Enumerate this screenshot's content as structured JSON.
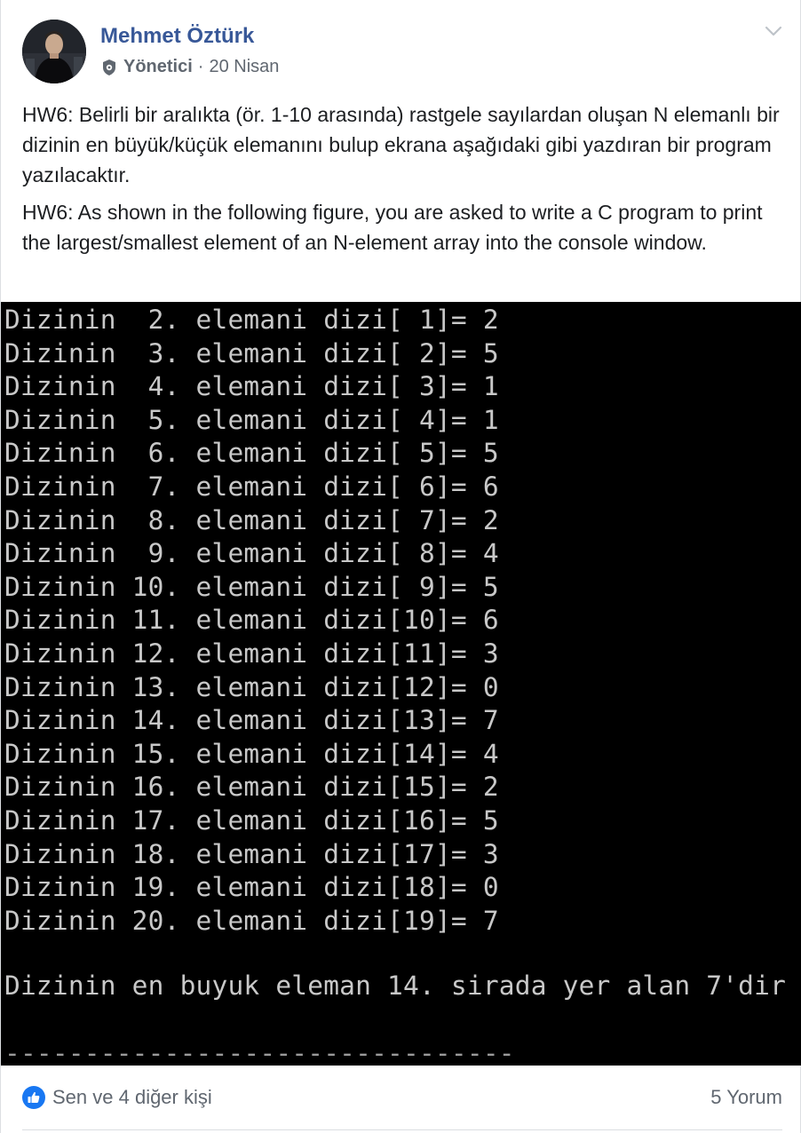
{
  "post": {
    "author": "Mehmet Öztürk",
    "role": "Yönetici",
    "separator": "·",
    "date": "20 Nisan",
    "paragraph_tr": "HW6: Belirli bir aralıkta (ör. 1-10 arasında) rastgele sayılardan oluşan N elemanlı bir dizinin en büyük/küçük elemanını bulup ekrana aşağıdaki gibi yazdıran bir program yazılacaktır.",
    "paragraph_en": "HW6: As shown in the following figure, you are asked to write a C program to print the largest/smallest element of an N-element array into the console window."
  },
  "console": {
    "lines": [
      "Dizinin  2. elemani dizi[ 1]= 2",
      "Dizinin  3. elemani dizi[ 2]= 5",
      "Dizinin  4. elemani dizi[ 3]= 1",
      "Dizinin  5. elemani dizi[ 4]= 1",
      "Dizinin  6. elemani dizi[ 5]= 5",
      "Dizinin  7. elemani dizi[ 6]= 6",
      "Dizinin  8. elemani dizi[ 7]= 2",
      "Dizinin  9. elemani dizi[ 8]= 4",
      "Dizinin 10. elemani dizi[ 9]= 5",
      "Dizinin 11. elemani dizi[10]= 6",
      "Dizinin 12. elemani dizi[11]= 3",
      "Dizinin 13. elemani dizi[12]= 0",
      "Dizinin 14. elemani dizi[13]= 7",
      "Dizinin 15. elemani dizi[14]= 4",
      "Dizinin 16. elemani dizi[15]= 2",
      "Dizinin 17. elemani dizi[16]= 5",
      "Dizinin 18. elemani dizi[17]= 3",
      "Dizinin 19. elemani dizi[18]= 0",
      "Dizinin 20. elemani dizi[19]= 7"
    ],
    "result": "Dizinin en buyuk eleman 14. sirada yer alan 7'dir",
    "separator_line": "--------------------------------"
  },
  "footer": {
    "reactions": "Sen ve 4 diğer kişi",
    "comments": "5 Yorum"
  },
  "colors": {
    "author": "#385898",
    "console_bg": "#000000",
    "console_text": "#c8c8c8",
    "like_blue": "#1877f2"
  },
  "icons": {
    "admin_badge": "shield-gear-icon",
    "menu": "chevron-down-icon",
    "like": "thumbs-up-icon"
  }
}
